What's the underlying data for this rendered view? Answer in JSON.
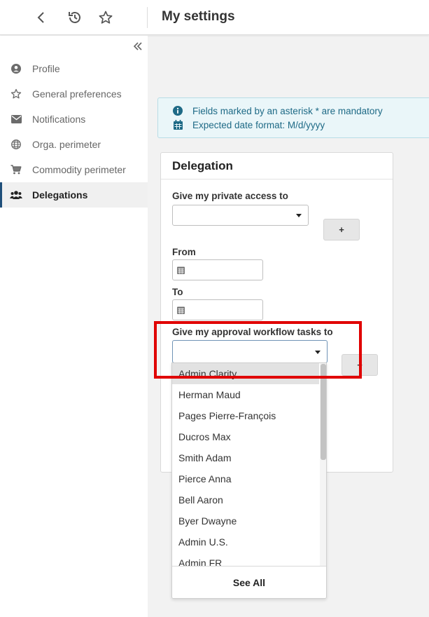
{
  "topbar": {
    "title": "My settings",
    "icons": [
      "back-icon",
      "history-icon",
      "star-icon"
    ]
  },
  "sidebar": {
    "collapse_icon": "double-chevron-left-icon",
    "items": [
      {
        "label": "Profile",
        "icon": "user-circle-icon"
      },
      {
        "label": "General preferences",
        "icon": "star-outline-icon"
      },
      {
        "label": "Notifications",
        "icon": "envelope-icon"
      },
      {
        "label": "Orga. perimeter",
        "icon": "globe-icon"
      },
      {
        "label": "Commodity perimeter",
        "icon": "cart-icon"
      },
      {
        "label": "Delegations",
        "icon": "users-icon",
        "active": true
      }
    ]
  },
  "info": {
    "mandatory_text": "Fields marked by an asterisk * are mandatory",
    "date_format_text": "Expected date format: M/d/yyyy",
    "color": "#1e6a86"
  },
  "delegation": {
    "title": "Delegation",
    "private_access_label": "Give my private access to",
    "private_access_value": "",
    "add_label": "+",
    "from_label": "From",
    "from_value": "",
    "to_label": "To",
    "to_value": "",
    "approval_label": "Give my approval workflow tasks to",
    "approval_value": "",
    "add_label_2": "+"
  },
  "dropdown": {
    "options": [
      "Admin Clarity",
      "Herman Maud",
      "Pages Pierre-François",
      "Ducros Max",
      "Smith Adam",
      "Pierce Anna",
      "Bell Aaron",
      "Byer Dwayne",
      "Admin U.S.",
      "Admin FR"
    ],
    "highlighted": "Admin Clarity",
    "see_all": "See All"
  },
  "colors": {
    "accent": "#1f4f7a",
    "highlight_box": "#e00000"
  }
}
